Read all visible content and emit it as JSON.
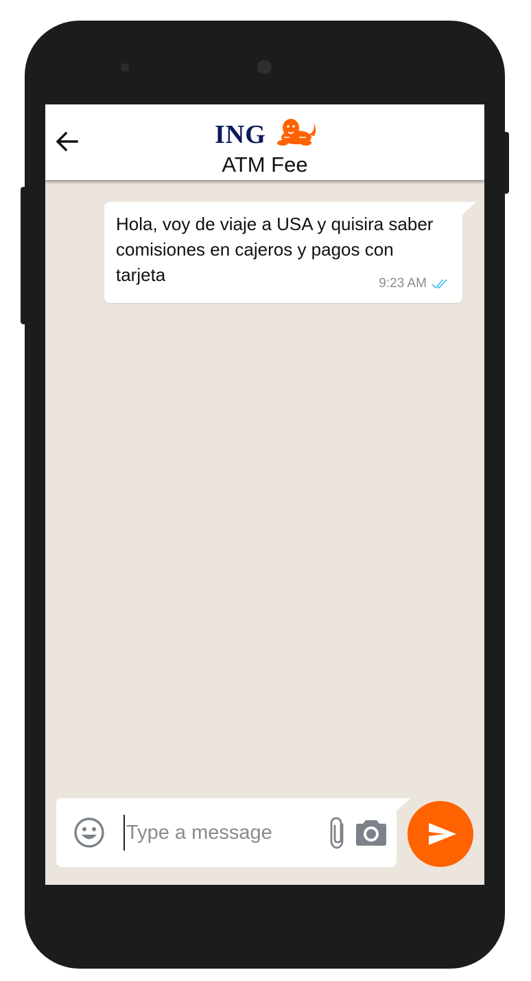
{
  "app": {
    "brand_name": "ING",
    "brand_color": "#ff6200",
    "brand_navy": "#0a1a5c"
  },
  "header": {
    "back_icon": "arrow-left-icon",
    "logo": "ING",
    "logo_icon": "lion-icon",
    "title": "ATM Fee"
  },
  "messages": [
    {
      "direction": "outgoing",
      "text": "Hola, voy de viaje a USA y quisira saber comisiones en cajeros y pagos con tarjeta",
      "time": "9:23 AM",
      "status_icon": "double-check-icon",
      "status_color": "#4fc3f7"
    }
  ],
  "composer": {
    "emoji_icon": "emoji-icon",
    "placeholder": "Type a message",
    "value": "",
    "attach_icon": "paperclip-icon",
    "camera_icon": "camera-icon",
    "send_icon": "send-icon"
  },
  "colors": {
    "chat_background": "#ece5dd",
    "bubble": "#ffffff",
    "send_button": "#ff6200"
  }
}
